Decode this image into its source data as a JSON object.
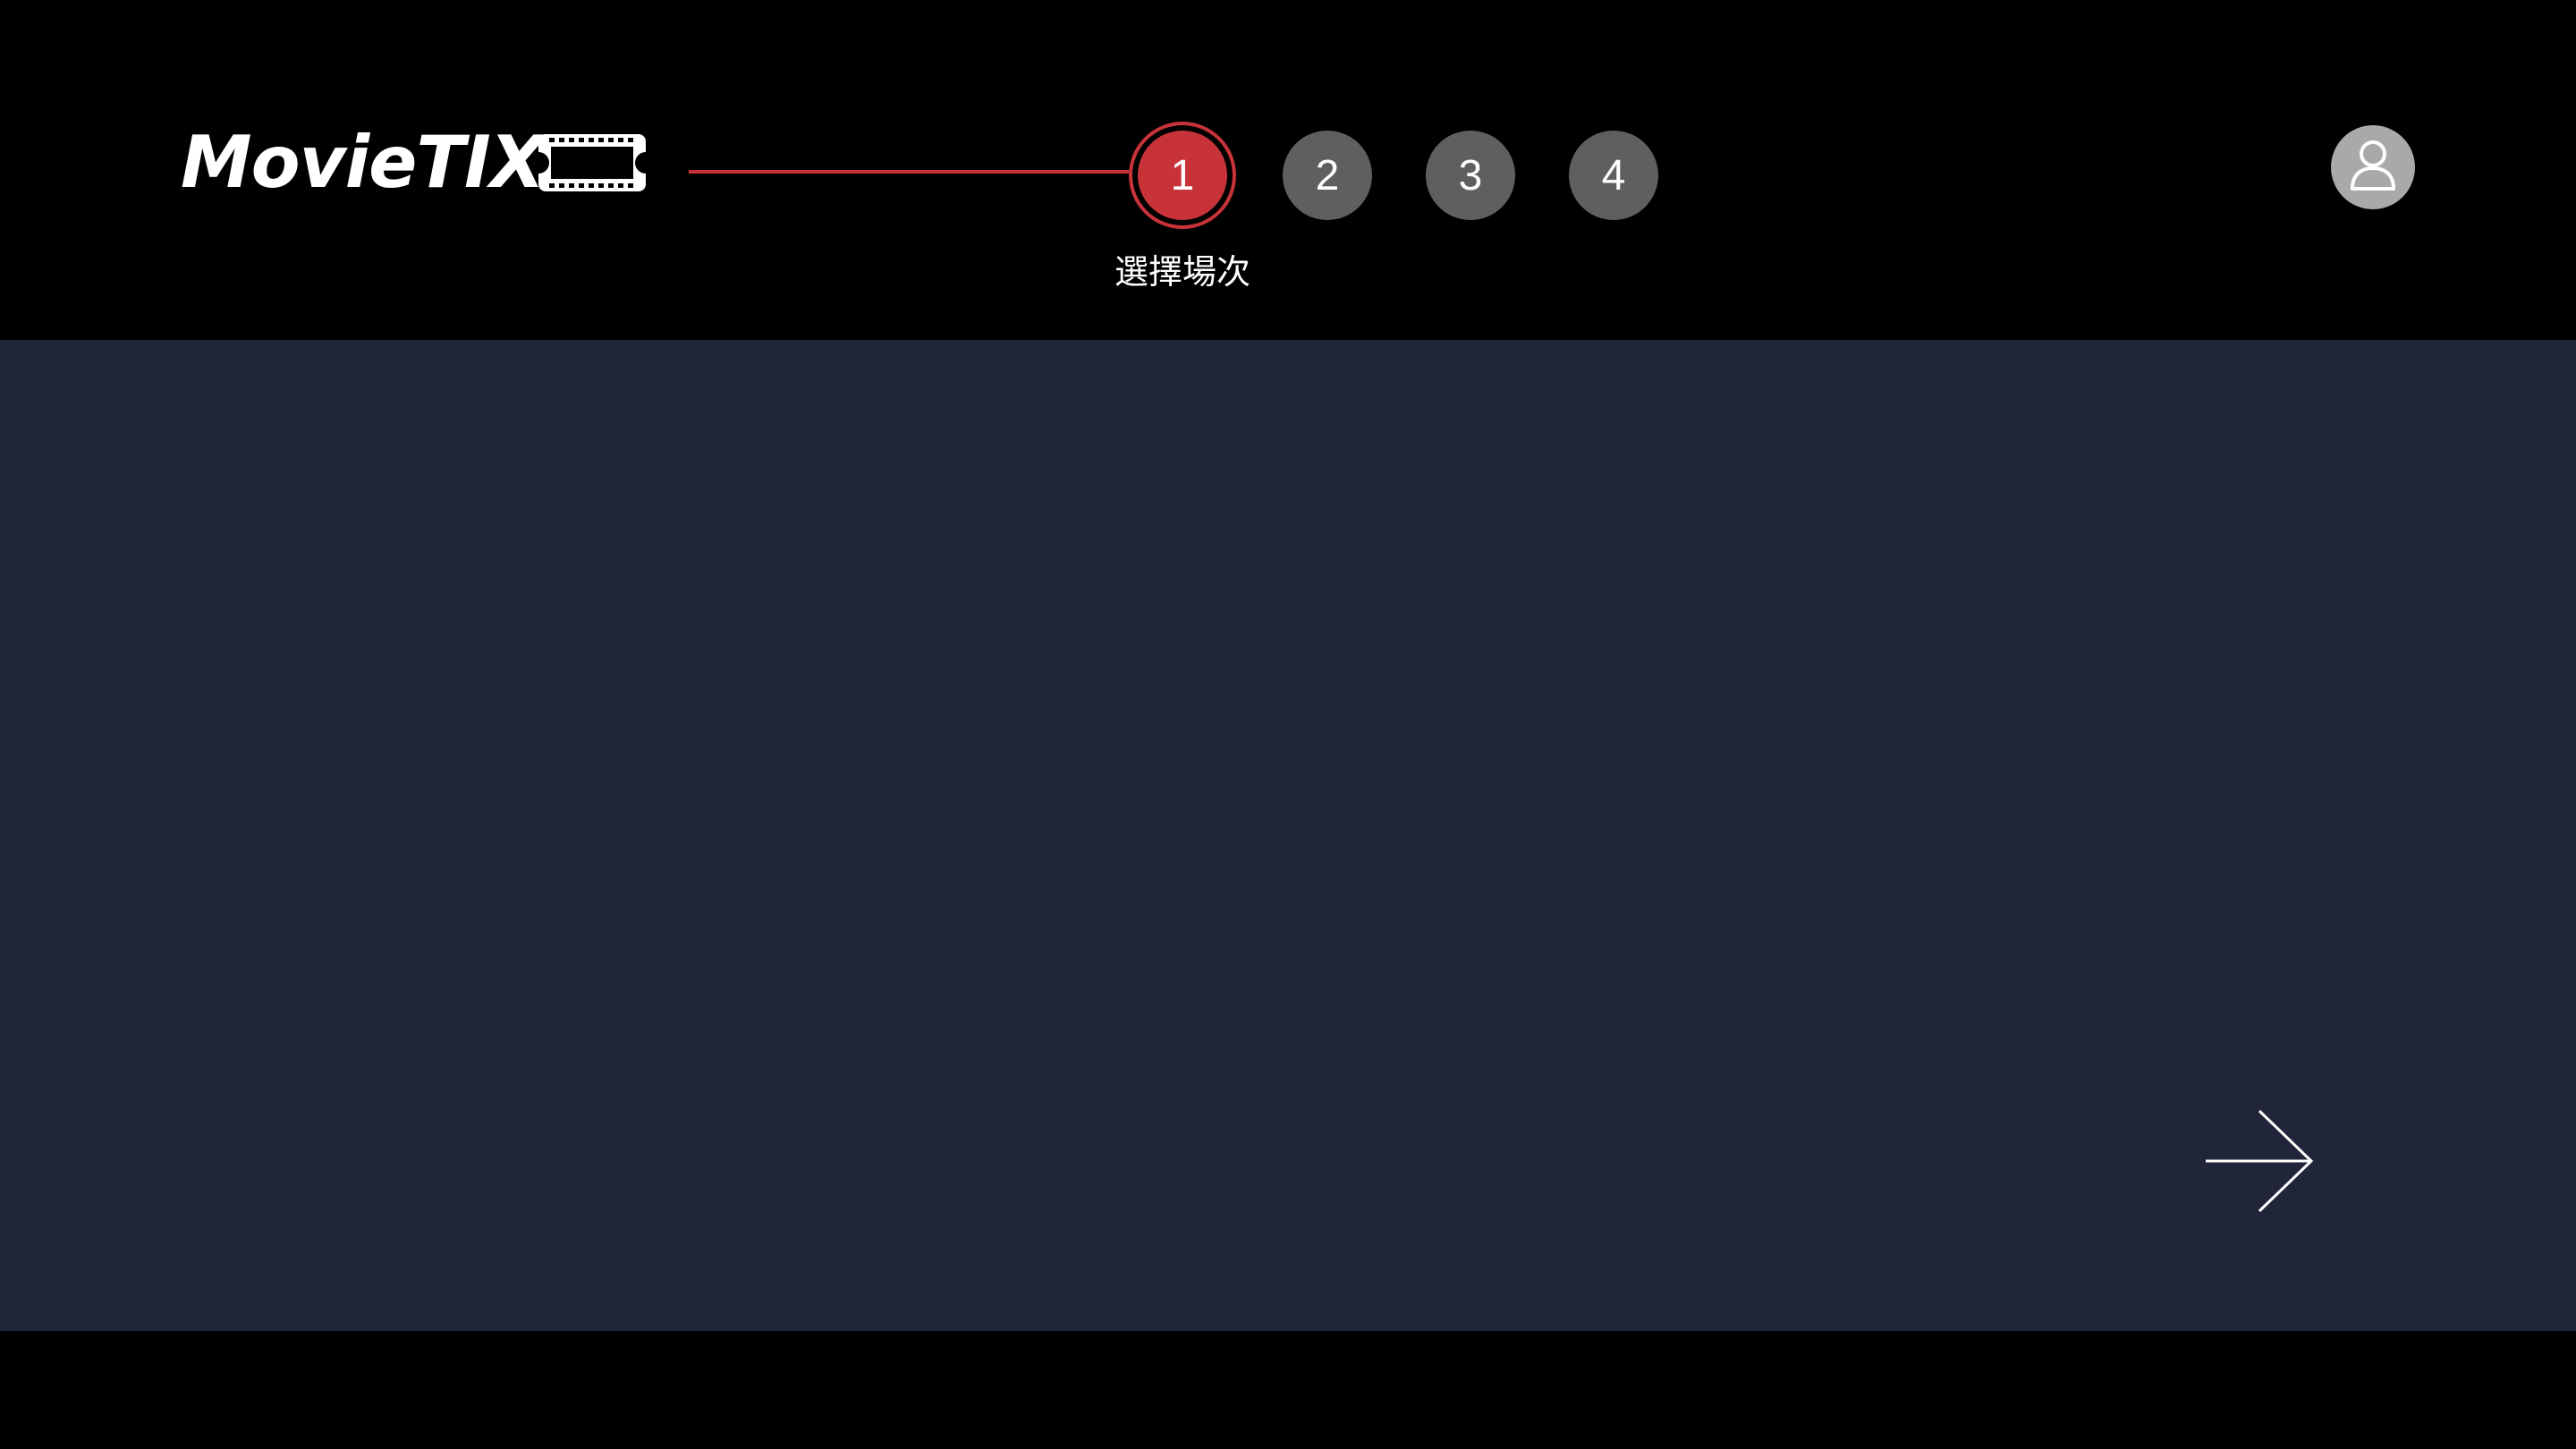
{
  "header": {
    "logo_text": "MovieTIX",
    "logo_icon": "ticket-icon"
  },
  "steps": {
    "items": [
      {
        "number": "1",
        "active": true
      },
      {
        "number": "2",
        "active": false
      },
      {
        "number": "3",
        "active": false
      },
      {
        "number": "4",
        "active": false
      }
    ],
    "active_label": "選擇場次"
  },
  "user": {
    "icon": "user-icon"
  },
  "navigation": {
    "next_icon": "arrow-right-icon"
  },
  "colors": {
    "accent": "#c8333a",
    "header_bg": "#000000",
    "main_bg": "#212539",
    "inactive_step": "#5f5f5f",
    "avatar_bg": "#a9a9a9"
  }
}
